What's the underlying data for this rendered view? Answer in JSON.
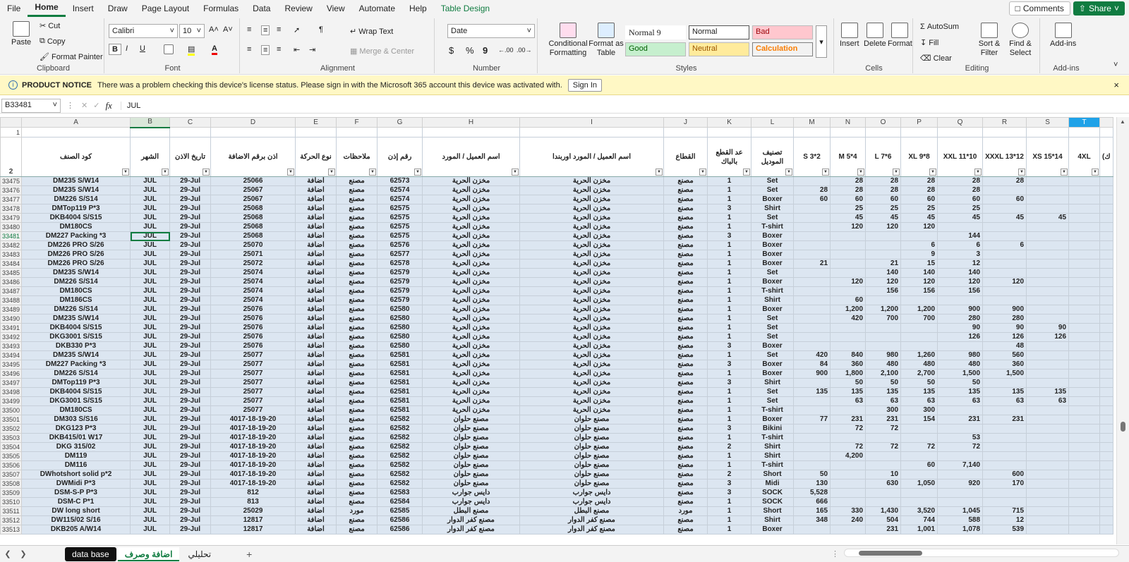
{
  "menu": [
    "File",
    "Home",
    "Insert",
    "Draw",
    "Page Layout",
    "Formulas",
    "Data",
    "Review",
    "View",
    "Automate",
    "Help",
    "Table Design"
  ],
  "menu_active": "Home",
  "topbuttons": {
    "comments": "Comments",
    "share": "Share"
  },
  "ribbon": {
    "clipboard": {
      "label": "Clipboard",
      "paste": "Paste",
      "cut": "Cut",
      "copy": "Copy",
      "format_painter": "Format Painter"
    },
    "font": {
      "label": "Font",
      "font_name": "Calibri",
      "font_size": "10",
      "bold": "B",
      "italic": "I",
      "underline": "U"
    },
    "alignment": {
      "label": "Alignment",
      "wrap_text": "Wrap Text",
      "merge_center": "Merge & Center"
    },
    "number": {
      "label": "Number",
      "format": "Date",
      "currency": "$",
      "percent": "%",
      "comma": "9"
    },
    "styles": {
      "label": "Styles",
      "conditional": "Conditional Formatting",
      "format_table": "Format as Table",
      "normal9": "Normal 9",
      "normal": "Normal",
      "bad": "Bad",
      "good": "Good",
      "neutral": "Neutral",
      "calculation": "Calculation"
    },
    "cells": {
      "label": "Cells",
      "insert": "Insert",
      "delete": "Delete",
      "format": "Format"
    },
    "editing": {
      "label": "Editing",
      "autosum": "AutoSum",
      "fill": "Fill",
      "clear": "Clear",
      "sort_filter": "Sort & Filter",
      "find_select": "Find & Select"
    },
    "addins": {
      "label": "Add-ins",
      "addins": "Add-ins"
    }
  },
  "notice": {
    "title": "PRODUCT NOTICE",
    "text": "There was a problem checking this device's license status. Please sign in with the Microsoft 365 account this device was activated with.",
    "button": "Sign In"
  },
  "formula_bar": {
    "name_box": "B33481",
    "fx": "fx",
    "value": "JUL"
  },
  "columns": [
    "A",
    "B",
    "C",
    "D",
    "E",
    "F",
    "G",
    "H",
    "I",
    "J",
    "K",
    "L",
    "M",
    "N",
    "O",
    "P",
    "Q",
    "R",
    "S",
    "T"
  ],
  "headers": [
    "كود الصنف",
    "الشهر",
    "تاريخ الاذن",
    "اذن برقم الاضافة",
    "نوع الحركة",
    "ملاحظات",
    "رقم إذن",
    "اسم العميل / المورد",
    "اسم العميل / المورد اوربندا",
    "القطاع",
    "عد القطع بالباك",
    "تصنيف الموديل",
    "S 3*2",
    "M 5*4",
    "L 7*6",
    "XL 9*8",
    "XXL 11*10",
    "XXXL 13*12",
    "XS 15*14",
    "4XL"
  ],
  "extra_header": "(ك",
  "rows": [
    [
      "33475",
      "DM235 S/W14",
      "JUL",
      "29-Jul",
      "25066",
      "اضافة",
      "مصنع",
      "62573",
      "مخزن الحرية",
      "مخزن الحرية",
      "مصنع",
      "1",
      "Set",
      "",
      "28",
      "28",
      "28",
      "28",
      "28",
      ""
    ],
    [
      "33476",
      "DM235 S/W14",
      "JUL",
      "29-Jul",
      "25067",
      "اضافة",
      "مصنع",
      "62574",
      "مخزن الحرية",
      "مخزن الحرية",
      "مصنع",
      "1",
      "Set",
      "28",
      "28",
      "28",
      "28",
      "28",
      "",
      ""
    ],
    [
      "33477",
      "DM226 S/S14",
      "JUL",
      "29-Jul",
      "25067",
      "اضافة",
      "مصنع",
      "62574",
      "مخزن الحرية",
      "مخزن الحرية",
      "مصنع",
      "1",
      "Boxer",
      "60",
      "60",
      "60",
      "60",
      "60",
      "60",
      ""
    ],
    [
      "33478",
      "DMTop119 P*3",
      "JUL",
      "29-Jul",
      "25068",
      "اضافة",
      "مصنع",
      "62575",
      "مخزن الحرية",
      "مخزن الحرية",
      "مصنع",
      "3",
      "Shirt",
      "",
      "25",
      "25",
      "25",
      "25",
      "",
      ""
    ],
    [
      "33479",
      "DKB4004 S/S15",
      "JUL",
      "29-Jul",
      "25068",
      "اضافة",
      "مصنع",
      "62575",
      "مخزن الحرية",
      "مخزن الحرية",
      "مصنع",
      "1",
      "Set",
      "",
      "45",
      "45",
      "45",
      "45",
      "45",
      "45"
    ],
    [
      "33480",
      "DM180CS",
      "JUL",
      "29-Jul",
      "25068",
      "اضافة",
      "مصنع",
      "62575",
      "مخزن الحرية",
      "مخزن الحرية",
      "مصنع",
      "1",
      "T-shirt",
      "",
      "120",
      "120",
      "120",
      "",
      "",
      ""
    ],
    [
      "33481",
      "DM227 Packing *3",
      "JUL",
      "29-Jul",
      "25068",
      "اضافة",
      "مصنع",
      "62575",
      "مخزن الحرية",
      "مخزن الحرية",
      "مصنع",
      "3",
      "Boxer",
      "",
      "",
      "",
      "",
      "144",
      "",
      ""
    ],
    [
      "33482",
      "DM226 PRO S/26",
      "JUL",
      "29-Jul",
      "25070",
      "اضافة",
      "مصنع",
      "62576",
      "مخزن الحرية",
      "مخزن الحرية",
      "مصنع",
      "1",
      "Boxer",
      "",
      "",
      "",
      "6",
      "6",
      "6",
      ""
    ],
    [
      "33483",
      "DM226 PRO S/26",
      "JUL",
      "29-Jul",
      "25071",
      "اضافة",
      "مصنع",
      "62577",
      "مخزن الحرية",
      "مخزن الحرية",
      "مصنع",
      "1",
      "Boxer",
      "",
      "",
      "",
      "9",
      "3",
      "",
      ""
    ],
    [
      "33484",
      "DM226 PRO S/26",
      "JUL",
      "29-Jul",
      "25072",
      "اضافة",
      "مصنع",
      "62578",
      "مخزن الحرية",
      "مخزن الحرية",
      "مصنع",
      "1",
      "Boxer",
      "21",
      "",
      "21",
      "15",
      "12",
      "",
      ""
    ],
    [
      "33485",
      "DM235 S/W14",
      "JUL",
      "29-Jul",
      "25074",
      "اضافة",
      "مصنع",
      "62579",
      "مخزن الحرية",
      "مخزن الحرية",
      "مصنع",
      "1",
      "Set",
      "",
      "",
      "140",
      "140",
      "140",
      "",
      ""
    ],
    [
      "33486",
      "DM226 S/S14",
      "JUL",
      "29-Jul",
      "25074",
      "اضافة",
      "مصنع",
      "62579",
      "مخزن الحرية",
      "مخزن الحرية",
      "مصنع",
      "1",
      "Boxer",
      "",
      "120",
      "120",
      "120",
      "120",
      "120",
      ""
    ],
    [
      "33487",
      "DM180CS",
      "JUL",
      "29-Jul",
      "25074",
      "اضافة",
      "مصنع",
      "62579",
      "مخزن الحرية",
      "مخزن الحرية",
      "مصنع",
      "1",
      "T-shirt",
      "",
      "",
      "156",
      "156",
      "156",
      "",
      ""
    ],
    [
      "33488",
      "DM186CS",
      "JUL",
      "29-Jul",
      "25074",
      "اضافة",
      "مصنع",
      "62579",
      "مخزن الحرية",
      "مخزن الحرية",
      "مصنع",
      "1",
      "Shirt",
      "",
      "60",
      "",
      "",
      "",
      "",
      ""
    ],
    [
      "33489",
      "DM226 S/S14",
      "JUL",
      "29-Jul",
      "25076",
      "اضافة",
      "مصنع",
      "62580",
      "مخزن الحرية",
      "مخزن الحرية",
      "مصنع",
      "1",
      "Boxer",
      "",
      "1,200",
      "1,200",
      "1,200",
      "900",
      "900",
      ""
    ],
    [
      "33490",
      "DM235 S/W14",
      "JUL",
      "29-Jul",
      "25076",
      "اضافة",
      "مصنع",
      "62580",
      "مخزن الحرية",
      "مخزن الحرية",
      "مصنع",
      "1",
      "Set",
      "",
      "420",
      "700",
      "700",
      "280",
      "280",
      ""
    ],
    [
      "33491",
      "DKB4004 S/S15",
      "JUL",
      "29-Jul",
      "25076",
      "اضافة",
      "مصنع",
      "62580",
      "مخزن الحرية",
      "مخزن الحرية",
      "مصنع",
      "1",
      "Set",
      "",
      "",
      "",
      "",
      "90",
      "90",
      "90"
    ],
    [
      "33492",
      "DKG3001 S/S15",
      "JUL",
      "29-Jul",
      "25076",
      "اضافة",
      "مصنع",
      "62580",
      "مخزن الحرية",
      "مخزن الحرية",
      "مصنع",
      "1",
      "Set",
      "",
      "",
      "",
      "",
      "126",
      "126",
      "126"
    ],
    [
      "33493",
      "DKB330 P*3",
      "JUL",
      "29-Jul",
      "25076",
      "اضافة",
      "مصنع",
      "62580",
      "مخزن الحرية",
      "مخزن الحرية",
      "مصنع",
      "3",
      "Boxer",
      "",
      "",
      "",
      "",
      "",
      "48",
      ""
    ],
    [
      "33494",
      "DM235 S/W14",
      "JUL",
      "29-Jul",
      "25077",
      "اضافة",
      "مصنع",
      "62581",
      "مخزن الحرية",
      "مخزن الحرية",
      "مصنع",
      "1",
      "Set",
      "420",
      "840",
      "980",
      "1,260",
      "980",
      "560",
      ""
    ],
    [
      "33495",
      "DM227 Packing *3",
      "JUL",
      "29-Jul",
      "25077",
      "اضافة",
      "مصنع",
      "62581",
      "مخزن الحرية",
      "مخزن الحرية",
      "مصنع",
      "3",
      "Boxer",
      "84",
      "360",
      "480",
      "480",
      "480",
      "360",
      ""
    ],
    [
      "33496",
      "DM226 S/S14",
      "JUL",
      "29-Jul",
      "25077",
      "اضافة",
      "مصنع",
      "62581",
      "مخزن الحرية",
      "مخزن الحرية",
      "مصنع",
      "1",
      "Boxer",
      "900",
      "1,800",
      "2,100",
      "2,700",
      "1,500",
      "1,500",
      ""
    ],
    [
      "33497",
      "DMTop119 P*3",
      "JUL",
      "29-Jul",
      "25077",
      "اضافة",
      "مصنع",
      "62581",
      "مخزن الحرية",
      "مخزن الحرية",
      "مصنع",
      "3",
      "Shirt",
      "",
      "50",
      "50",
      "50",
      "50",
      "",
      ""
    ],
    [
      "33498",
      "DKB4004 S/S15",
      "JUL",
      "29-Jul",
      "25077",
      "اضافة",
      "مصنع",
      "62581",
      "مخزن الحرية",
      "مخزن الحرية",
      "مصنع",
      "1",
      "Set",
      "135",
      "135",
      "135",
      "135",
      "135",
      "135",
      "135"
    ],
    [
      "33499",
      "DKG3001 S/S15",
      "JUL",
      "29-Jul",
      "25077",
      "اضافة",
      "مصنع",
      "62581",
      "مخزن الحرية",
      "مخزن الحرية",
      "مصنع",
      "1",
      "Set",
      "",
      "63",
      "63",
      "63",
      "63",
      "63",
      "63"
    ],
    [
      "33500",
      "DM180CS",
      "JUL",
      "29-Jul",
      "25077",
      "اضافة",
      "مصنع",
      "62581",
      "مخزن الحرية",
      "مخزن الحرية",
      "مصنع",
      "1",
      "T-shirt",
      "",
      "",
      "300",
      "300",
      "",
      "",
      ""
    ],
    [
      "33501",
      "DM303 S/S16",
      "JUL",
      "29-Jul",
      "4017-18-19-20",
      "اضافة",
      "مصنع",
      "62582",
      "مصنع حلوان",
      "مصنع حلوان",
      "مصنع",
      "1",
      "Boxer",
      "77",
      "231",
      "231",
      "154",
      "231",
      "231",
      ""
    ],
    [
      "33502",
      "DKG123 P*3",
      "JUL",
      "29-Jul",
      "4017-18-19-20",
      "اضافة",
      "مصنع",
      "62582",
      "مصنع حلوان",
      "مصنع حلوان",
      "مصنع",
      "3",
      "Bikini",
      "",
      "72",
      "72",
      "",
      "",
      "",
      ""
    ],
    [
      "33503",
      "DKB415/01 W17",
      "JUL",
      "29-Jul",
      "4017-18-19-20",
      "اضافة",
      "مصنع",
      "62582",
      "مصنع حلوان",
      "مصنع حلوان",
      "مصنع",
      "1",
      "T-shirt",
      "",
      "",
      "",
      "",
      "53",
      "",
      ""
    ],
    [
      "33504",
      "DKG 315/02",
      "JUL",
      "29-Jul",
      "4017-18-19-20",
      "اضافة",
      "مصنع",
      "62582",
      "مصنع حلوان",
      "مصنع حلوان",
      "مصنع",
      "2",
      "Shirt",
      "",
      "72",
      "72",
      "72",
      "72",
      "",
      ""
    ],
    [
      "33505",
      "DM119",
      "JUL",
      "29-Jul",
      "4017-18-19-20",
      "اضافة",
      "مصنع",
      "62582",
      "مصنع حلوان",
      "مصنع حلوان",
      "مصنع",
      "1",
      "Shirt",
      "",
      "4,200",
      "",
      "",
      "",
      "",
      ""
    ],
    [
      "33506",
      "DM116",
      "JUL",
      "29-Jul",
      "4017-18-19-20",
      "اضافة",
      "مصنع",
      "62582",
      "مصنع حلوان",
      "مصنع حلوان",
      "مصنع",
      "1",
      "T-shirt",
      "",
      "",
      "",
      "60",
      "7,140",
      "",
      ""
    ],
    [
      "33507",
      "DWhotshort solid p*2",
      "JUL",
      "29-Jul",
      "4017-18-19-20",
      "اضافة",
      "مصنع",
      "62582",
      "مصنع حلوان",
      "مصنع حلوان",
      "مصنع",
      "2",
      "Short",
      "50",
      "",
      "10",
      "",
      "",
      "600",
      ""
    ],
    [
      "33508",
      "DWMidi P*3",
      "JUL",
      "29-Jul",
      "4017-18-19-20",
      "اضافة",
      "مصنع",
      "62582",
      "مصنع حلوان",
      "مصنع حلوان",
      "مصنع",
      "3",
      "Midi",
      "130",
      "",
      "630",
      "1,050",
      "920",
      "170",
      ""
    ],
    [
      "33509",
      "DSM-S-P P*3",
      "JUL",
      "29-Jul",
      "812",
      "اضافة",
      "مصنع",
      "62583",
      "دايس جوارب",
      "دايس جوارب",
      "مصنع",
      "3",
      "SOCK",
      "5,528",
      "",
      "",
      "",
      "",
      "",
      ""
    ],
    [
      "33510",
      "DSM-C P*1",
      "JUL",
      "29-Jul",
      "813",
      "اضافة",
      "مصنع",
      "62584",
      "دايس جوارب",
      "دايس جوارب",
      "مصنع",
      "1",
      "SOCK",
      "666",
      "",
      "",
      "",
      "",
      "",
      ""
    ],
    [
      "33511",
      "DW long short",
      "JUL",
      "29-Jul",
      "25029",
      "اضافة",
      "مورد",
      "62585",
      "مصنع البطل",
      "مصنع البطل",
      "مورد",
      "1",
      "Short",
      "165",
      "330",
      "1,430",
      "3,520",
      "1,045",
      "715",
      ""
    ],
    [
      "33512",
      "DW115/02 S/16",
      "JUL",
      "29-Jul",
      "12817",
      "اضافة",
      "مصنع",
      "62586",
      "مصنع كفر الدوار",
      "مصنع كفر الدوار",
      "مصنع",
      "1",
      "Shirt",
      "348",
      "240",
      "504",
      "744",
      "588",
      "12",
      ""
    ],
    [
      "33513",
      "DKB205 A/W14",
      "JUL",
      "29-Jul",
      "12817",
      "اضافة",
      "مصنع",
      "62586",
      "مصنع كفر الدوار",
      "مصنع كفر الدوار",
      "مصنع",
      "1",
      "Boxer",
      "",
      "",
      "231",
      "1,001",
      "1,078",
      "539",
      ""
    ]
  ],
  "selected_row": "33481",
  "sheet_tabs": [
    "data base",
    "اضافة وصرف",
    "تحليلي"
  ],
  "active_tab": "اضافة وصرف",
  "colors": {
    "accent": "#107c41",
    "row_fill": "#dce6f1",
    "highlight_col": "#1fa2e8",
    "notice": "#fff8c5"
  }
}
